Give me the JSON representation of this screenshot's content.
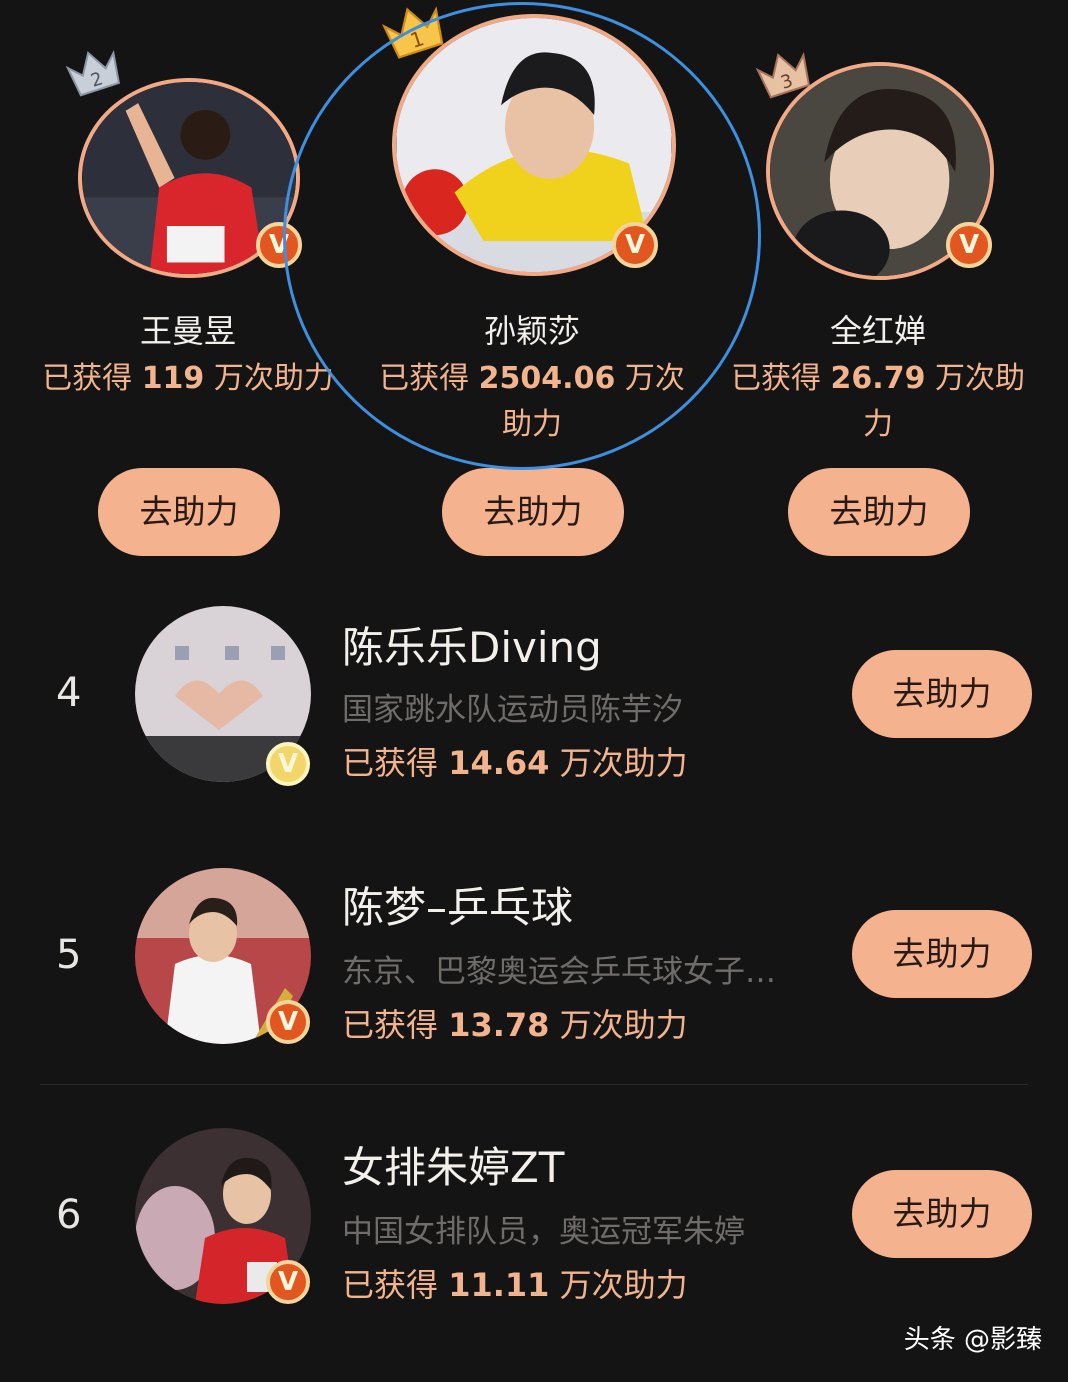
{
  "podium": [
    {
      "rank": "2",
      "name": "王曼昱",
      "prefix": "已获得 ",
      "value": "119",
      "suffix": " 万次助力",
      "button": "去助力",
      "badge": "V"
    },
    {
      "rank": "1",
      "name": "孙颖莎",
      "prefix": "已获得 ",
      "value": "2504.06",
      "suffix": " 万次助力",
      "button": "去助力",
      "badge": "V"
    },
    {
      "rank": "3",
      "name": "全红婵",
      "prefix": "已获得 ",
      "value": "26.79",
      "suffix": " 万次助力",
      "button": "去助力",
      "badge": "V"
    }
  ],
  "list": [
    {
      "rank": "4",
      "name": "陈乐乐Diving",
      "desc": "国家跳水队运动员陈芋汐",
      "prefix": "已获得 ",
      "value": "14.64",
      "suffix": " 万次助力",
      "button": "去助力",
      "badge": "V",
      "badge_color": "#f2d66a"
    },
    {
      "rank": "5",
      "name": "陈梦–乒乓球",
      "desc": "东京、巴黎奥运会乒乓球女子单打冠军",
      "prefix": "已获得 ",
      "value": "13.78",
      "suffix": " 万次助力",
      "button": "去助力",
      "badge": "V",
      "badge_color": "#e2561f"
    },
    {
      "rank": "6",
      "name": "女排朱婷ZT",
      "desc": "中国女排队员，奥运冠军朱婷",
      "prefix": "已获得 ",
      "value": "11.11",
      "suffix": " 万次助力",
      "button": "去助力",
      "badge": "V",
      "badge_color": "#e2561f"
    }
  ],
  "watermark": "头条 @影臻",
  "colors": {
    "accent": "#f5b28e",
    "count_text": "#f2b48e",
    "highlight": "#3d8fe0",
    "background": "#151414"
  }
}
